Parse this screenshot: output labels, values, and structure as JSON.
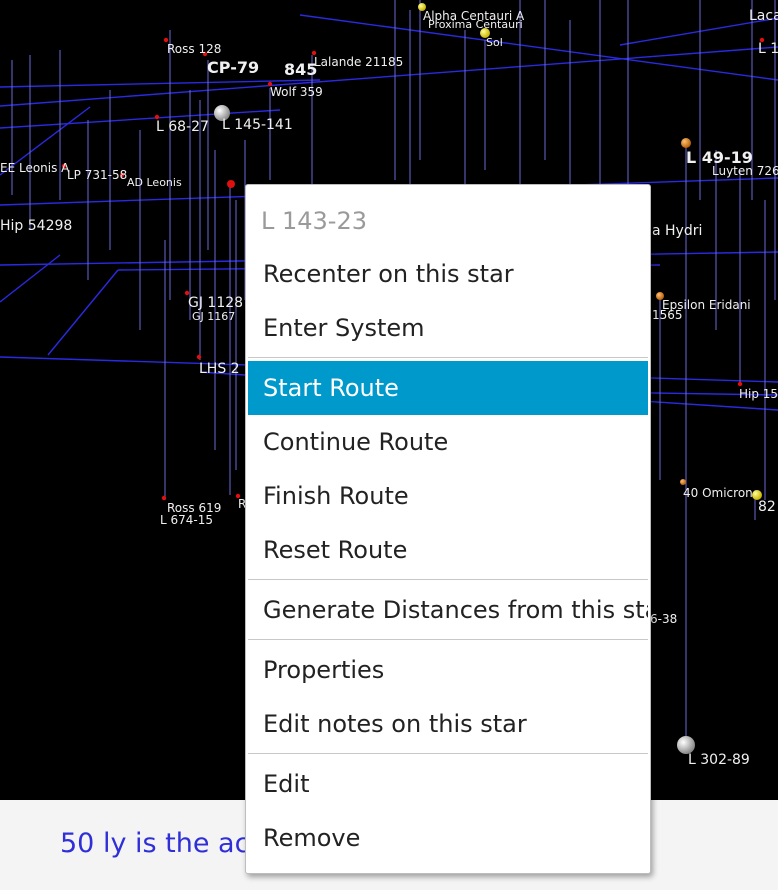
{
  "viewport": {
    "star_labels": [
      {
        "name": "Alpha Centauri A"
      },
      {
        "name": "Proxima Centauri"
      },
      {
        "name": "Sol"
      },
      {
        "name": "Laca"
      },
      {
        "name": "L 1"
      },
      {
        "name": "Ross 128"
      },
      {
        "name": "CP-79"
      },
      {
        "name": "845"
      },
      {
        "name": "Lalande 21185"
      },
      {
        "name": "Wolf 359"
      },
      {
        "name": "L 68-27"
      },
      {
        "name": "L 145-141"
      },
      {
        "name": "L 49-19"
      },
      {
        "name": "Luyten 726"
      },
      {
        "name": "EE Leonis A"
      },
      {
        "name": "LP 731-58"
      },
      {
        "name": "AD Leonis"
      },
      {
        "name": "Hip 54298"
      },
      {
        "name": "a Hydri"
      },
      {
        "name": "GJ 1128"
      },
      {
        "name": "GJ 1167"
      },
      {
        "name": "Epsilon Eridani"
      },
      {
        "name": "1565"
      },
      {
        "name": "LHS 2"
      },
      {
        "name": "Hip 15"
      },
      {
        "name": "40 Omicron"
      },
      {
        "name": "82"
      },
      {
        "name": "Ross 619"
      },
      {
        "name": "L 674-15"
      },
      {
        "name": "R"
      },
      {
        "name": "6-38"
      },
      {
        "name": "L 302-89"
      }
    ]
  },
  "context_menu": {
    "title": "L 143-23",
    "groups": [
      [
        "Recenter on this star",
        "Enter System"
      ],
      [
        "Start Route",
        "Continue Route",
        "Finish Route",
        "Reset Route"
      ],
      [
        "Generate Distances from this star"
      ],
      [
        "Properties",
        "Edit notes on this star"
      ],
      [
        "Edit",
        "Remove"
      ]
    ],
    "highlighted_item": "Start Route",
    "highlight_color": "#0099cc"
  },
  "status_bar": {
    "text": "50 ly is the ac"
  },
  "colors": {
    "grid_line": "#2a2ae0",
    "stem_line": "#6a6ad8",
    "status_text": "#2f2fd8",
    "background": "#000000"
  }
}
